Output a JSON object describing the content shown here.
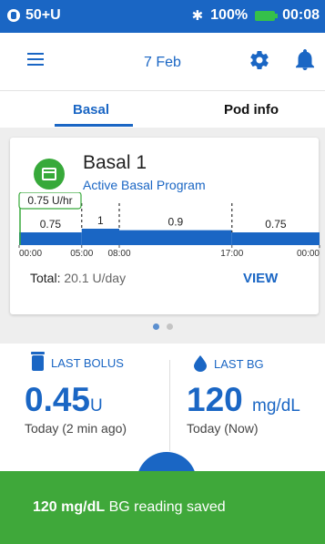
{
  "status_bar": {
    "pod_label": "50+U",
    "bluetooth_icon": "bluetooth-icon",
    "battery_percent": "100%",
    "battery_color": "#35c04a",
    "time": "00:08"
  },
  "header": {
    "menu_icon": "hamburger-menu-icon",
    "date": "7 Feb",
    "settings_icon": "gear-icon",
    "notifications_icon": "bell-icon"
  },
  "tabs": [
    {
      "label": "Basal",
      "active": true
    },
    {
      "label": "Pod info",
      "active": false
    }
  ],
  "basal_card": {
    "program_icon": "calendar-icon",
    "program_name": "Basal 1",
    "program_status": "Active Basal Program",
    "current_rate": "0.75 U/hr",
    "total_label": "Total:",
    "total_value": "20.1 U/day",
    "view_label": "VIEW"
  },
  "chart_data": {
    "type": "area",
    "title": "",
    "xlabel": "",
    "ylabel": "",
    "x_ticks": [
      "00:00",
      "05:00",
      "08:00",
      "17:00",
      "00:00"
    ],
    "segments": [
      {
        "start": 0,
        "end": 5,
        "rate": 0.75,
        "label": "0.75"
      },
      {
        "start": 5,
        "end": 8,
        "rate": 1,
        "label": "1"
      },
      {
        "start": 8,
        "end": 17,
        "rate": 0.9,
        "label": "0.9"
      },
      {
        "start": 17,
        "end": 24,
        "rate": 0.75,
        "label": "0.75"
      }
    ],
    "xlim": [
      0,
      24
    ],
    "grid": false,
    "color": "#1a66c4",
    "current_marker_color": "#37a93a"
  },
  "pager": {
    "count": 2,
    "active": 0
  },
  "last_bolus": {
    "icon": "insulin-vial-icon",
    "label": "LAST BOLUS",
    "value": "0.45",
    "unit": "U",
    "time": "Today (2 min ago)"
  },
  "last_bg": {
    "icon": "blood-drop-icon",
    "label": "LAST BG",
    "value": "120",
    "unit": "mg/dL",
    "time": "Today (Now)"
  },
  "snackbar": {
    "value": "120 mg/dL",
    "message": "BG reading saved",
    "color": "#3fa83a"
  },
  "colors": {
    "primary": "#1a66c4",
    "success": "#3fa83a"
  }
}
